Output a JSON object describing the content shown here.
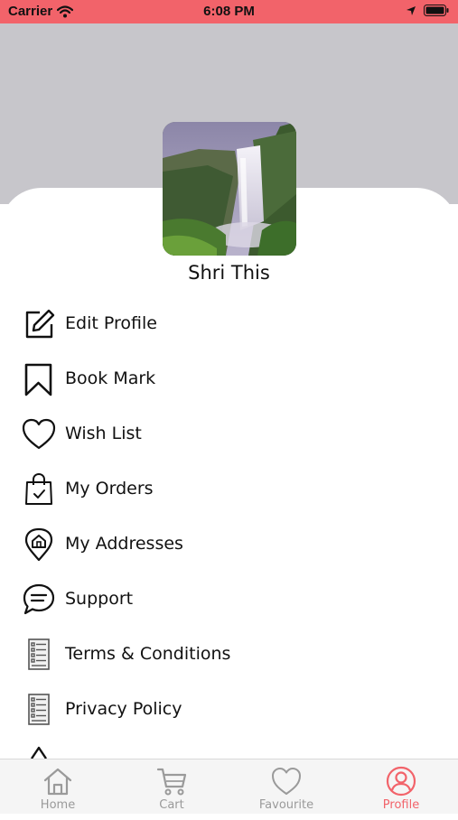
{
  "status_bar": {
    "carrier": "Carrier",
    "time": "6:08 PM"
  },
  "profile": {
    "name": "Shri This",
    "avatar_icon": "waterfall-photo"
  },
  "menu": [
    {
      "label": "Edit Profile",
      "icon": "edit-icon"
    },
    {
      "label": "Book Mark",
      "icon": "bookmark-icon"
    },
    {
      "label": "Wish List",
      "icon": "heart-icon"
    },
    {
      "label": "My Orders",
      "icon": "shopping-bag-icon"
    },
    {
      "label": "My Addresses",
      "icon": "location-pin-icon"
    },
    {
      "label": "Support",
      "icon": "chat-bubble-icon"
    },
    {
      "label": "Terms & Conditions",
      "icon": "document-list-icon"
    },
    {
      "label": "Privacy Policy",
      "icon": "document-list-icon"
    }
  ],
  "tabs": [
    {
      "label": "Home",
      "icon": "home-icon",
      "active": false
    },
    {
      "label": "Cart",
      "icon": "cart-icon",
      "active": false
    },
    {
      "label": "Favourite",
      "icon": "heart-icon",
      "active": false
    },
    {
      "label": "Profile",
      "icon": "user-icon",
      "active": true
    }
  ],
  "colors": {
    "accent": "#f2636a",
    "header_band": "#c7c6cb",
    "tab_inactive": "#9a9a9a"
  }
}
